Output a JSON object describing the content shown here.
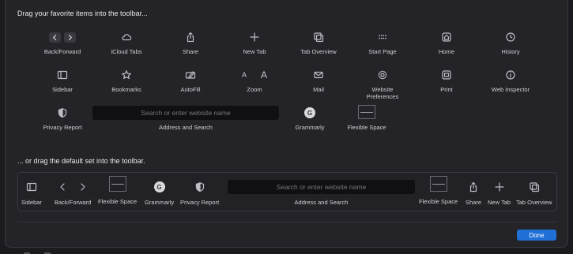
{
  "headings": {
    "top": "Drag your favorite items into the toolbar...",
    "middle": "... or drag the default set into the toolbar."
  },
  "palette": [
    {
      "label": "Back/Forward",
      "icon": "back-forward-icon"
    },
    {
      "label": "iCloud Tabs",
      "icon": "cloud-icon"
    },
    {
      "label": "Share",
      "icon": "share-icon"
    },
    {
      "label": "New Tab",
      "icon": "plus-icon"
    },
    {
      "label": "Tab Overview",
      "icon": "tab-overview-icon"
    },
    {
      "label": "Start Page",
      "icon": "grid-icon"
    },
    {
      "label": "Home",
      "icon": "house-icon"
    },
    {
      "label": "History",
      "icon": "clock-icon"
    },
    {
      "label": "Sidebar",
      "icon": "sidebar-icon"
    },
    {
      "label": "Bookmarks",
      "icon": "star-icon"
    },
    {
      "label": "AutoFill",
      "icon": "autofill-icon"
    },
    {
      "label": "Zoom",
      "icon": "zoom-icon"
    },
    {
      "label": "Mail",
      "icon": "envelope-icon"
    },
    {
      "label": "Website Preferences",
      "icon": "gear-icon"
    },
    {
      "label": "Print",
      "icon": "printer-icon"
    },
    {
      "label": "Web Inspector",
      "icon": "info-icon"
    },
    {
      "label": "Privacy Report",
      "icon": "shield-icon"
    },
    {
      "label": "Address and Search",
      "icon": "address-field"
    },
    {
      "label": "Grammarly",
      "icon": "grammarly-icon"
    },
    {
      "label": "Flexible Space",
      "icon": "flexible-space-icon"
    }
  ],
  "zoom": {
    "small": "A",
    "large": "A"
  },
  "grammarly_glyph": "G",
  "search_placeholder": "Search or enter website name",
  "default_set": [
    {
      "label": "Sidebar"
    },
    {
      "label": "Back/Forward"
    },
    {
      "label": "Flexible Space"
    },
    {
      "label": "Grammarly"
    },
    {
      "label": "Privacy Report"
    },
    {
      "label": "Address and Search"
    },
    {
      "label": "Flexible Space"
    },
    {
      "label": "Share"
    },
    {
      "label": "New Tab"
    },
    {
      "label": "Tab Overview"
    }
  ],
  "done_label": "Done",
  "colors": {
    "accent": "#1f6fd6",
    "background": "#242328"
  }
}
